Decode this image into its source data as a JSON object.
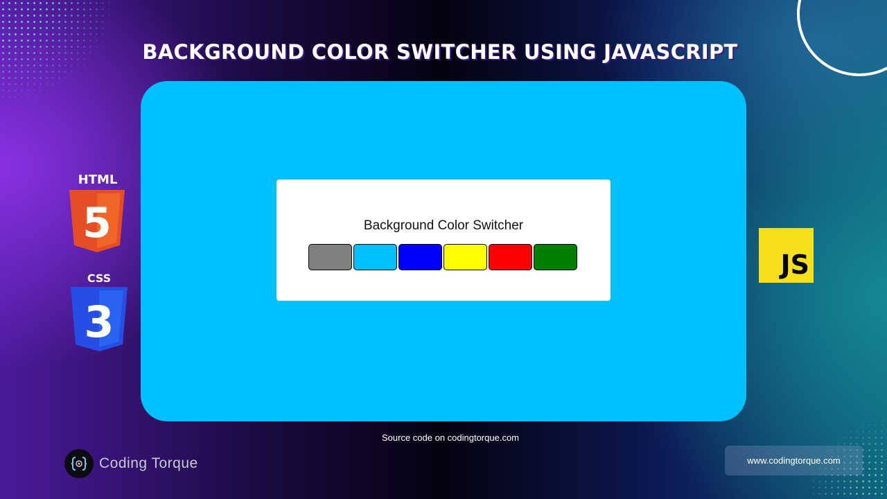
{
  "banner": {
    "title": "BACKGROUND COLOR SWITCHER USING JAVASCRIPT",
    "source_note": "Source code on codingtorque.com",
    "brand_name": "Coding Torque",
    "url": "www.codingtorque.com"
  },
  "logos": {
    "html_label": "HTML",
    "html_number": "5",
    "css_label": "CSS",
    "css_number": "3",
    "js_label": "JS"
  },
  "app": {
    "background_color": "#00bfff",
    "card_title": "Background Color Switcher",
    "swatches": [
      {
        "name": "grey",
        "color": "#808080"
      },
      {
        "name": "deepskyblue",
        "color": "#00bfff"
      },
      {
        "name": "blue",
        "color": "#0000ff"
      },
      {
        "name": "yellow",
        "color": "#ffff00"
      },
      {
        "name": "red",
        "color": "#ff0000"
      },
      {
        "name": "green",
        "color": "#008000"
      }
    ]
  },
  "colors": {
    "html_orange": "#e44d26",
    "css_blue": "#264de4",
    "js_yellow": "#f7df1e",
    "brand_accent": "#7ec8e3"
  }
}
